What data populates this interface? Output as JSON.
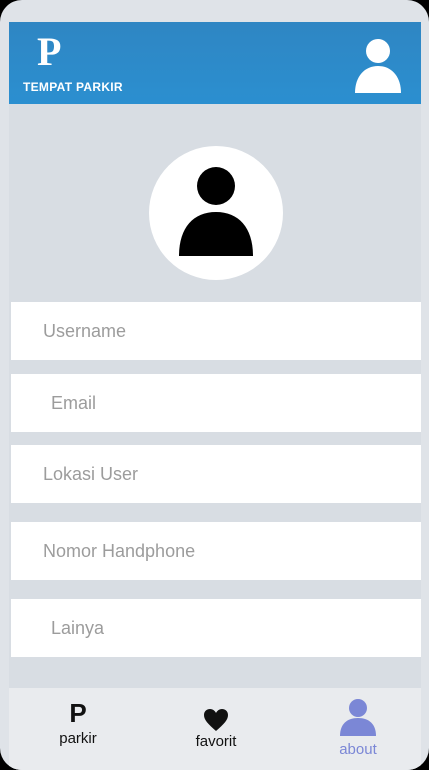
{
  "header": {
    "logo_letter": "P",
    "app_name": "TEMPAT PARKIR",
    "user_icon": "user-icon"
  },
  "profile": {
    "avatar_icon": "person-icon"
  },
  "form": {
    "username_placeholder": "Username",
    "email_placeholder": "Email",
    "location_placeholder": "Lokasi User",
    "phone_placeholder": "Nomor Handphone",
    "other_placeholder": "Lainya"
  },
  "nav": {
    "items": [
      {
        "label": "parkir",
        "icon": "p-icon"
      },
      {
        "label": "favorit",
        "icon": "heart-icon"
      },
      {
        "label": "about",
        "icon": "person-icon"
      }
    ],
    "active_color": "#7b87d6",
    "active": "about"
  },
  "colors": {
    "header_blue": "#2b8fd0",
    "background": "#d8dde3",
    "nav_background": "#e9ebee"
  }
}
